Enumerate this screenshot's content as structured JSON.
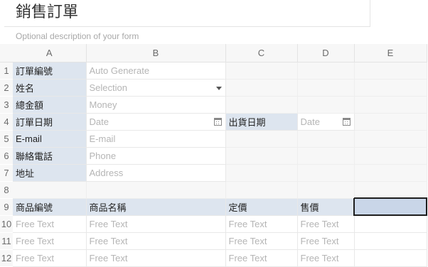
{
  "form": {
    "title": "銷售訂單",
    "description": "Optional description of your form"
  },
  "columns": [
    "A",
    "B",
    "C",
    "D",
    "E"
  ],
  "row_numbers": [
    "1",
    "2",
    "3",
    "4",
    "5",
    "6",
    "7",
    "8",
    "9",
    "10",
    "11",
    "12"
  ],
  "rows": {
    "r1": {
      "label": "訂單編號",
      "placeholder": "Auto Generate"
    },
    "r2": {
      "label": "姓名",
      "placeholder": "Selection"
    },
    "r3": {
      "label": "總金額",
      "placeholder": "Money"
    },
    "r4": {
      "label": "訂單日期",
      "placeholder": "Date",
      "label2": "出貨日期",
      "placeholder2": "Date"
    },
    "r5": {
      "label": "E-mail",
      "placeholder": "E-mail"
    },
    "r6": {
      "label": "聯絡電話",
      "placeholder": "Phone"
    },
    "r7": {
      "label": "地址",
      "placeholder": "Address"
    }
  },
  "table_headers": [
    "商品編號",
    "商品名稱",
    "定價",
    "售價"
  ],
  "table_placeholder": "Free Text",
  "icons": {
    "date": "calendar-icon",
    "select": "dropdown-caret-icon"
  },
  "colors": {
    "label_bg": "#dde5ef",
    "selected_bg": "#c9d6e8"
  }
}
